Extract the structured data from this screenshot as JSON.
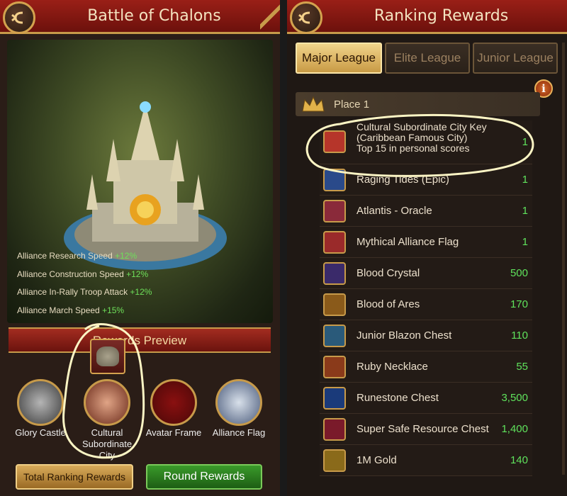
{
  "left": {
    "title": "Battle of Chalons",
    "stats": [
      {
        "label": "Alliance Research Speed",
        "value": "+12%"
      },
      {
        "label": "Alliance Construction Speed",
        "value": "+12%"
      },
      {
        "label": "Alliance In-Rally Troop Attack",
        "value": "+12%"
      },
      {
        "label": "Alliance March Speed",
        "value": "+15%"
      }
    ],
    "rewards_preview_label": "Rewards Preview",
    "reward_items": [
      {
        "label": "Glory Castle"
      },
      {
        "label": "Cultural Subordinate City"
      },
      {
        "label": "Avatar Frame"
      },
      {
        "label": "Alliance Flag"
      }
    ],
    "buttons": {
      "total": "Total Ranking Rewards",
      "round": "Round Rewards"
    }
  },
  "right": {
    "title": "Ranking Rewards",
    "tabs": [
      {
        "label": "Major League",
        "active": true
      },
      {
        "label": "Elite League",
        "active": false
      },
      {
        "label": "Junior League",
        "active": false
      }
    ],
    "info_icon": "i",
    "place_label": "Place 1",
    "items": [
      {
        "name": "Cultural Subordinate City Key (Caribbean Famous City)",
        "sub": "Top 15 in personal scores",
        "qty": "1",
        "icon": "key-icon",
        "color": "#b6352a"
      },
      {
        "name": "Raging Tides (Epic)",
        "qty": "1",
        "icon": "wave-icon",
        "color": "#2a4a8a"
      },
      {
        "name": "Atlantis - Oracle",
        "qty": "1",
        "icon": "oracle-icon",
        "color": "#8a2a3a"
      },
      {
        "name": "Mythical Alliance Flag",
        "qty": "1",
        "icon": "flag-icon",
        "color": "#9a2a2a"
      },
      {
        "name": "Blood Crystal",
        "qty": "500",
        "icon": "crystal-icon",
        "color": "#3a2a6a"
      },
      {
        "name": "Blood of Ares",
        "qty": "170",
        "icon": "blood-icon",
        "color": "#8a5a1a"
      },
      {
        "name": "Junior Blazon Chest",
        "qty": "110",
        "icon": "chest-icon",
        "color": "#2a5a7a"
      },
      {
        "name": "Ruby Necklace",
        "qty": "55",
        "icon": "necklace-icon",
        "color": "#8a3a1a"
      },
      {
        "name": "Runestone Chest",
        "qty": "3,500",
        "icon": "runestone-chest-icon",
        "color": "#1a3a7a"
      },
      {
        "name": "Super Safe Resource Chest",
        "qty": "1,400",
        "icon": "resource-chest-icon",
        "color": "#7a1a2a"
      },
      {
        "name": "1M Gold",
        "qty": "140",
        "icon": "gold-icon",
        "color": "#8a6a1a"
      }
    ]
  }
}
